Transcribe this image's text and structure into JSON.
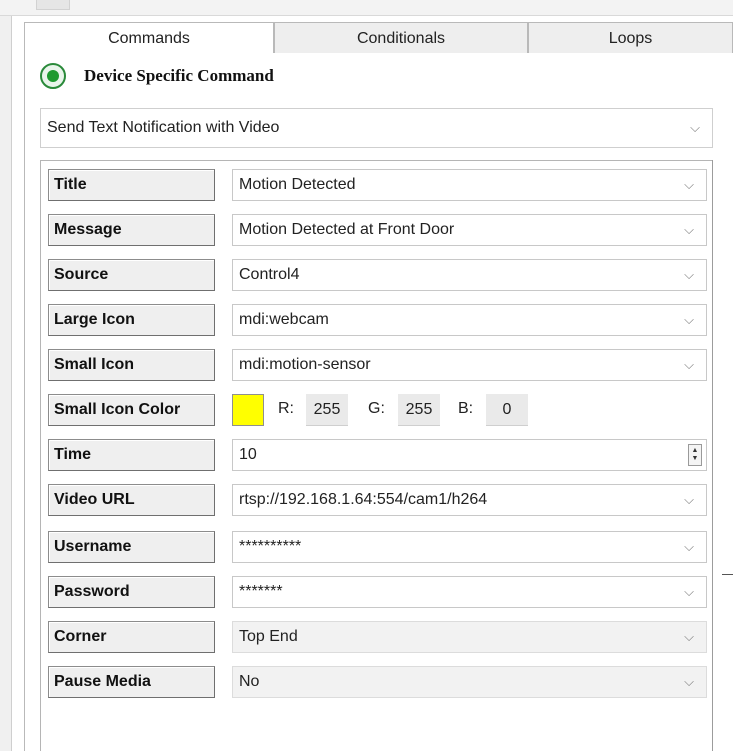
{
  "tabs": [
    {
      "label": "Commands",
      "active": true
    },
    {
      "label": "Conditionals",
      "active": false
    },
    {
      "label": "Loops",
      "active": false
    }
  ],
  "command_type": {
    "label": "Device Specific Command",
    "selected": true
  },
  "command_select": {
    "value": "Send Text Notification with Video"
  },
  "params": {
    "title": {
      "label": "Title",
      "value": "Motion Detected"
    },
    "message": {
      "label": "Message",
      "value": "Motion Detected at Front Door"
    },
    "source": {
      "label": "Source",
      "value": "Control4"
    },
    "large_icon": {
      "label": "Large Icon",
      "value": "mdi:webcam"
    },
    "small_icon": {
      "label": "Small Icon",
      "value": "mdi:motion-sensor"
    },
    "small_icon_color": {
      "label": "Small Icon Color",
      "swatch": "#ffff00",
      "r_label": "R:",
      "r": "255",
      "g_label": "G:",
      "g": "255",
      "b_label": "B:",
      "b": "0"
    },
    "time": {
      "label": "Time",
      "value": "10"
    },
    "video_url": {
      "label": "Video URL",
      "value": "rtsp://192.168.1.64:554/cam1/h264"
    },
    "username": {
      "label": "Username",
      "value": "**********"
    },
    "password": {
      "label": "Password",
      "value": "*******"
    },
    "corner": {
      "label": "Corner",
      "value": "Top End"
    },
    "pause_media": {
      "label": "Pause Media",
      "value": "No"
    }
  },
  "icons": {
    "dropdown": "chevron-down-icon",
    "spinner": "spinner-arrows-icon",
    "radio": "radio-selected-icon"
  },
  "colors": {
    "radio_accent": "#1e9a2f",
    "swatch": "#ffff00"
  }
}
